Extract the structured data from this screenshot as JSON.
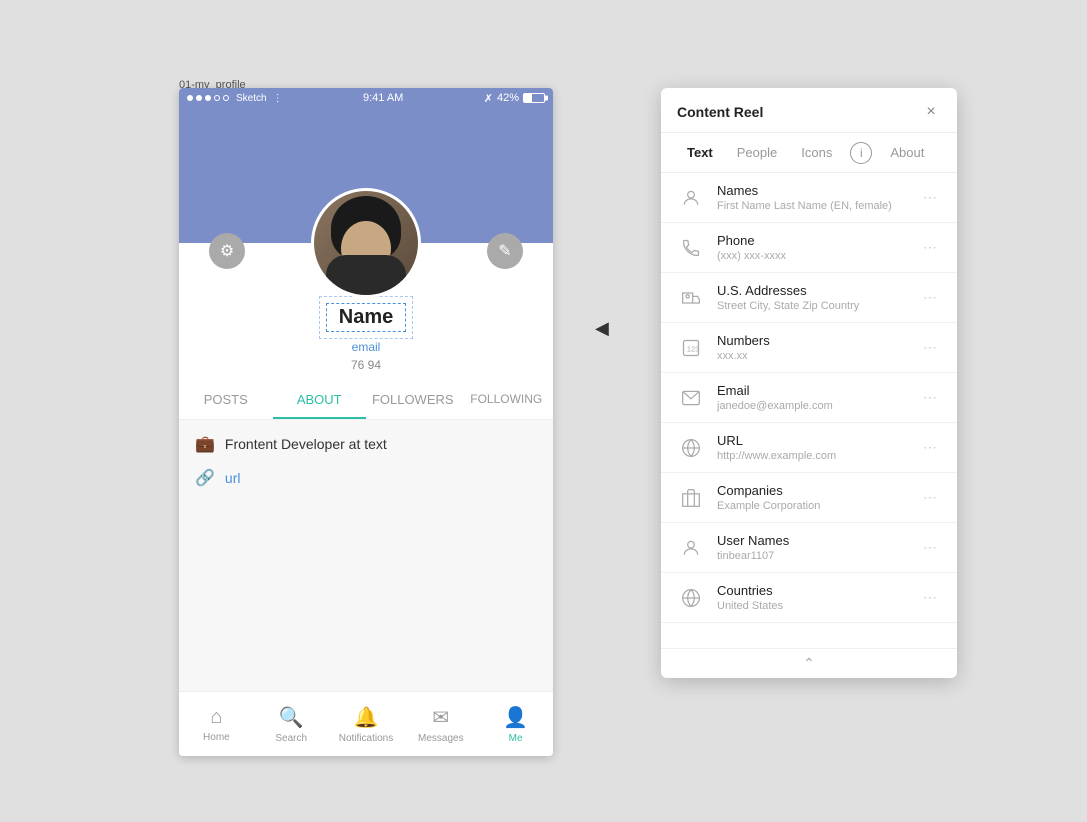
{
  "file_label": "01-my_profile",
  "status_bar": {
    "dots": [
      "filled",
      "filled",
      "filled",
      "empty",
      "empty"
    ],
    "app": "Sketch",
    "time": "9:41 AM",
    "bluetooth": "⌘",
    "battery": "42%"
  },
  "profile": {
    "name": "Name",
    "email": "email",
    "stats": "76  94",
    "settings_icon": "⚙",
    "edit_icon": "✎"
  },
  "tabs": [
    {
      "label": "POSTS",
      "active": false
    },
    {
      "label": "ABOUT",
      "active": true
    },
    {
      "label": "FOLLOWERS",
      "active": false
    },
    {
      "label": "FOLLOWING",
      "active": false
    }
  ],
  "about": {
    "job": "Frontent Developer at text",
    "url": "url"
  },
  "bottom_nav": [
    {
      "icon": "🏠",
      "label": "Home",
      "active": false
    },
    {
      "icon": "🔍",
      "label": "Search",
      "active": false
    },
    {
      "icon": "🔔",
      "label": "Notifications",
      "active": false
    },
    {
      "icon": "✉",
      "label": "Messages",
      "active": false
    },
    {
      "icon": "👤",
      "label": "Me",
      "active": true
    }
  ],
  "panel": {
    "title": "Content Reel",
    "tabs": [
      {
        "label": "Text",
        "active": true
      },
      {
        "label": "People",
        "active": false
      },
      {
        "label": "Icons",
        "active": false
      },
      {
        "label": "About",
        "active": false
      }
    ],
    "items": [
      {
        "title": "Names",
        "subtitle": "First Name Last Name (EN, female)",
        "icon": "person"
      },
      {
        "title": "Phone",
        "subtitle": "(xxx) xxx-xxxx",
        "icon": "phone"
      },
      {
        "title": "U.S. Addresses",
        "subtitle": "Street City, State Zip Country",
        "icon": "address"
      },
      {
        "title": "Numbers",
        "subtitle": "xxx.xx",
        "icon": "numbers"
      },
      {
        "title": "Email",
        "subtitle": "janedoe@example.com",
        "icon": "email"
      },
      {
        "title": "URL",
        "subtitle": "http://www.example.com",
        "icon": "url"
      },
      {
        "title": "Companies",
        "subtitle": "Example Corporation",
        "icon": "companies"
      },
      {
        "title": "User Names",
        "subtitle": "tinbear1107",
        "icon": "user"
      },
      {
        "title": "Countries",
        "subtitle": "United States",
        "icon": "countries"
      }
    ]
  }
}
